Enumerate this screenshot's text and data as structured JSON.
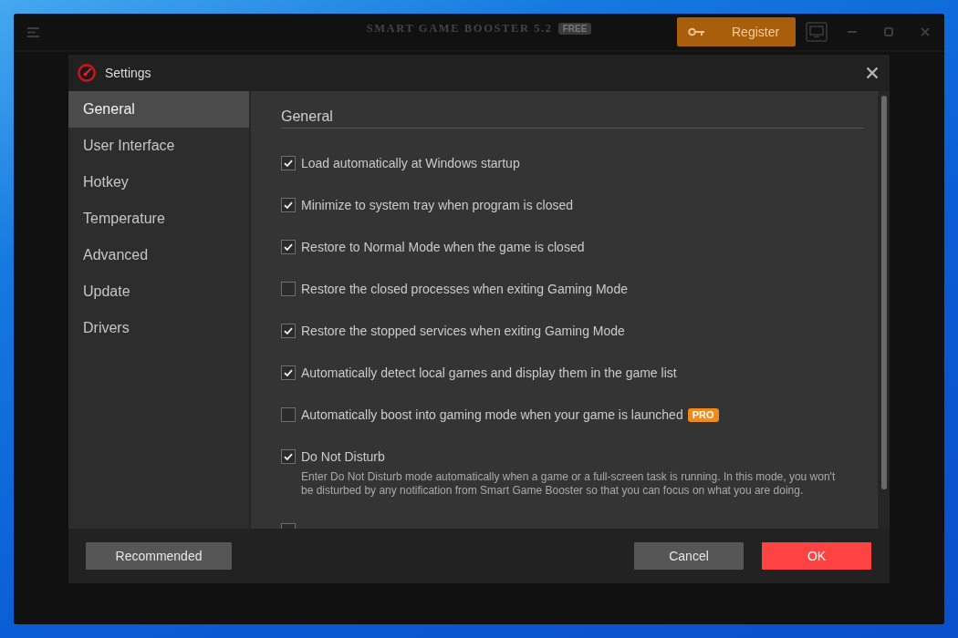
{
  "app": {
    "title": "SMART GAME BOOSTER 5.2",
    "edition_badge": "FREE",
    "register_button": "Register"
  },
  "dialog": {
    "title": "Settings",
    "sidebar": [
      {
        "label": "General",
        "selected": true
      },
      {
        "label": "User Interface",
        "selected": false
      },
      {
        "label": "Hotkey",
        "selected": false
      },
      {
        "label": "Temperature",
        "selected": false
      },
      {
        "label": "Advanced",
        "selected": false
      },
      {
        "label": "Update",
        "selected": false
      },
      {
        "label": "Drivers",
        "selected": false
      }
    ],
    "section_title": "General",
    "options": [
      {
        "label": "Load automatically at Windows startup",
        "checked": true
      },
      {
        "label": "Minimize to system tray when program is closed",
        "checked": true
      },
      {
        "label": "Restore to Normal Mode when the game is closed",
        "checked": true
      },
      {
        "label": "Restore the closed processes when exiting Gaming Mode",
        "checked": false
      },
      {
        "label": "Restore the stopped services when exiting Gaming Mode",
        "checked": true
      },
      {
        "label": "Automatically detect local games and display them in the game list",
        "checked": true
      },
      {
        "label": "Automatically boost into gaming mode when your game is launched",
        "checked": false,
        "badge": "PRO"
      },
      {
        "label": "Do Not Disturb",
        "checked": true,
        "description": "Enter Do Not Disturb mode automatically when a game or a full-screen task is running. In this mode, you won't be disturbed by any notification from Smart Game Booster so that you can focus on what you are doing."
      },
      {
        "checked": false
      }
    ],
    "footer_left": [
      {
        "label": "Recommended",
        "kind": "secondary"
      }
    ],
    "footer_right": [
      {
        "label": "Cancel",
        "kind": "secondary"
      },
      {
        "label": "OK",
        "kind": "primary"
      }
    ]
  }
}
